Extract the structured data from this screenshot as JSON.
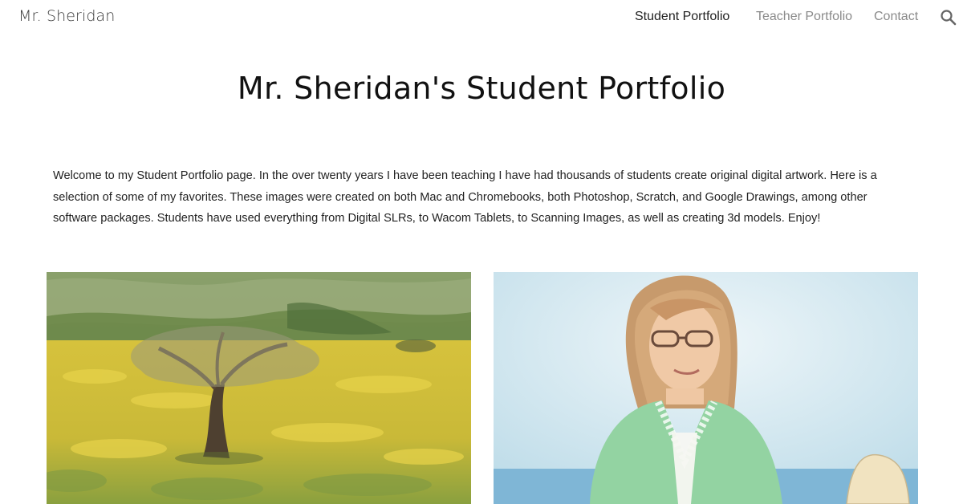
{
  "header": {
    "site_title": "Mr. Sheridan",
    "nav": [
      {
        "label": "Student Portfolio",
        "active": true
      },
      {
        "label": "Teacher Portfolio",
        "active": false
      },
      {
        "label": "Contact",
        "active": false
      }
    ],
    "search_icon": "search-icon"
  },
  "main": {
    "title": "Mr. Sheridan's Student Portfolio",
    "intro": "Welcome to my Student Portfolio page. In the over twenty years I have been teaching I have had thousands of students create original digital artwork. Here is a selection of some of my favorites. These images were created on both Mac and Chromebooks, both Photoshop, Scratch, and Google Drawings, among other software packages. Students have used everything from Digital SLRs, to Wacom Tablets, to Scanning Images, as well as creating 3d models. Enjoy!"
  },
  "gallery": [
    {
      "subject": "tree-in-yellow-field-painting"
    },
    {
      "subject": "woman-with-glasses-portrait-drawing"
    }
  ],
  "colors": {
    "nav_active": "#222222",
    "nav_inactive": "#8a8a8a",
    "field_yellow": "#d9c43a",
    "hills_green": "#7f9a5c",
    "portrait_sky": "#cfe6f0",
    "blouse_green": "#8fcf9a"
  }
}
